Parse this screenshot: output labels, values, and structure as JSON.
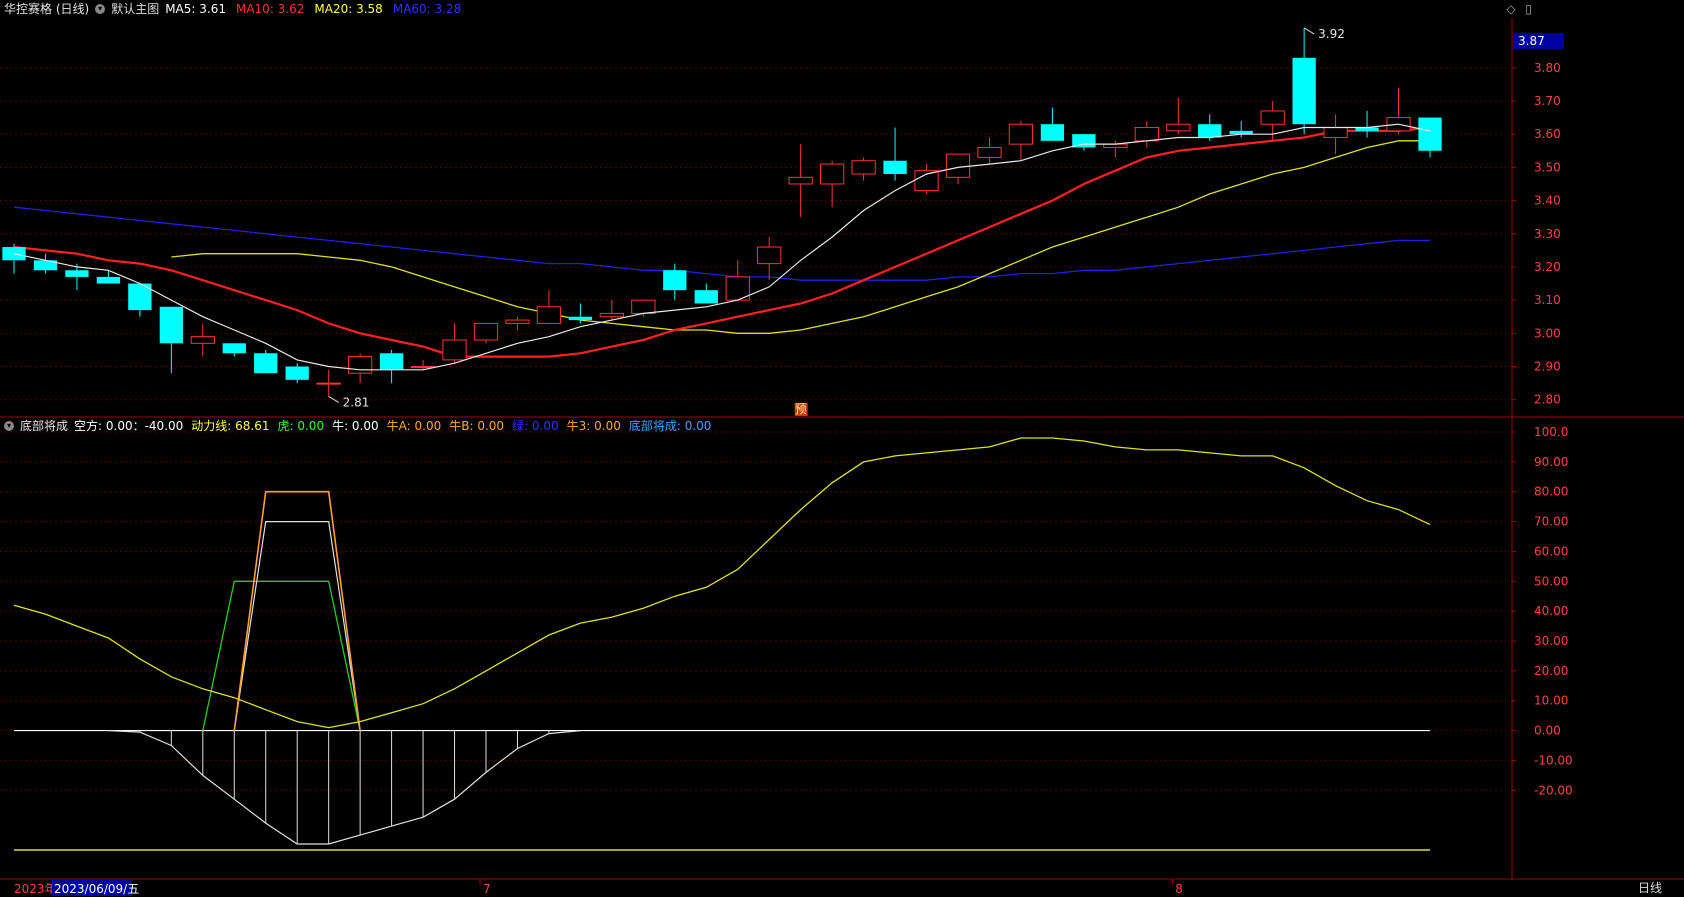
{
  "window": {
    "stock_name": "华控赛格 (日线)",
    "main_chart_label": "默认主图",
    "ma_labels": [
      {
        "text": "MA5: 3.61",
        "color": "#ffffff"
      },
      {
        "text": "MA10: 3.62",
        "color": "#ff3030"
      },
      {
        "text": "MA20: 3.58",
        "color": "#ffff40"
      },
      {
        "text": "MA60: 3.28",
        "color": "#3030ff"
      }
    ],
    "current_price_tag": "3.87",
    "high_label": "3.92",
    "low_label": "2.81",
    "forecast_badge": "预"
  },
  "indicator": {
    "name": "底部将成",
    "items": [
      {
        "text": "空方: 0.00：-40.00",
        "color": "#ffffff"
      },
      {
        "text": "动力线: 68.61",
        "color": "#ffff40"
      },
      {
        "text": "虎: 0.00",
        "color": "#30ff30"
      },
      {
        "text": "牛: 0.00",
        "color": "#ffffff"
      },
      {
        "text": "牛A: 0.00",
        "color": "#ffaa30"
      },
      {
        "text": "牛B: 0.00",
        "color": "#ffaa30"
      },
      {
        "text": "绿: 0.00",
        "color": "#3030ff"
      },
      {
        "text": "牛3: 0.00",
        "color": "#ffaa30"
      },
      {
        "text": "底部将成: 0.00",
        "color": "#40a0ff"
      }
    ]
  },
  "price_axis": {
    "ticks": [
      "3.80",
      "3.70",
      "3.60",
      "3.50",
      "3.40",
      "3.30",
      "3.20",
      "3.10",
      "3.00",
      "2.90",
      "2.80"
    ]
  },
  "ind_axis": {
    "ticks": [
      "100.0",
      "90.00",
      "80.00",
      "70.00",
      "60.00",
      "50.00",
      "40.00",
      "30.00",
      "20.00",
      "10.00",
      "0.00",
      "-10.00",
      "-20.00"
    ]
  },
  "time_axis": {
    "year_label": "2023年",
    "cursor_date": "2023/06/09/五",
    "month_marks": [
      "7",
      "8"
    ],
    "period_button": "日线"
  },
  "chart_data": [
    {
      "type": "candlestick",
      "title": "华控赛格 (日线)",
      "ylim": [
        2.76,
        3.95
      ],
      "candles": [
        {
          "o": 3.26,
          "h": 3.27,
          "l": 3.18,
          "c": 3.22
        },
        {
          "o": 3.22,
          "h": 3.24,
          "l": 3.18,
          "c": 3.19
        },
        {
          "o": 3.19,
          "h": 3.21,
          "l": 3.13,
          "c": 3.17
        },
        {
          "o": 3.17,
          "h": 3.19,
          "l": 3.15,
          "c": 3.15
        },
        {
          "o": 3.15,
          "h": 3.15,
          "l": 3.05,
          "c": 3.07
        },
        {
          "o": 3.08,
          "h": 3.08,
          "l": 2.88,
          "c": 2.97
        },
        {
          "o": 2.97,
          "h": 3.03,
          "l": 2.93,
          "c": 2.99
        },
        {
          "o": 2.97,
          "h": 2.97,
          "l": 2.93,
          "c": 2.94
        },
        {
          "o": 2.94,
          "h": 2.95,
          "l": 2.88,
          "c": 2.88
        },
        {
          "o": 2.9,
          "h": 2.91,
          "l": 2.85,
          "c": 2.86
        },
        {
          "o": 2.85,
          "h": 2.89,
          "l": 2.81,
          "c": 2.85
        },
        {
          "o": 2.88,
          "h": 2.94,
          "l": 2.85,
          "c": 2.93
        },
        {
          "o": 2.94,
          "h": 2.95,
          "l": 2.85,
          "c": 2.89
        },
        {
          "o": 2.9,
          "h": 2.92,
          "l": 2.89,
          "c": 2.9
        },
        {
          "o": 2.92,
          "h": 3.03,
          "l": 2.91,
          "c": 2.98
        },
        {
          "o": 2.98,
          "h": 3.02,
          "l": 2.97,
          "c": 3.03
        },
        {
          "o": 3.03,
          "h": 3.05,
          "l": 3.01,
          "c": 3.04
        },
        {
          "o": 3.03,
          "h": 3.13,
          "l": 3.03,
          "c": 3.08
        },
        {
          "o": 3.05,
          "h": 3.09,
          "l": 3.03,
          "c": 3.04
        },
        {
          "o": 3.05,
          "h": 3.1,
          "l": 3.04,
          "c": 3.06
        },
        {
          "o": 3.06,
          "h": 3.1,
          "l": 3.05,
          "c": 3.1
        },
        {
          "o": 3.19,
          "h": 3.21,
          "l": 3.1,
          "c": 3.13
        },
        {
          "o": 3.13,
          "h": 3.15,
          "l": 3.09,
          "c": 3.09
        },
        {
          "o": 3.1,
          "h": 3.22,
          "l": 3.1,
          "c": 3.17
        },
        {
          "o": 3.21,
          "h": 3.29,
          "l": 3.16,
          "c": 3.26
        },
        {
          "o": 3.45,
          "h": 3.57,
          "l": 3.35,
          "c": 3.47
        },
        {
          "o": 3.45,
          "h": 3.52,
          "l": 3.38,
          "c": 3.51
        },
        {
          "o": 3.48,
          "h": 3.53,
          "l": 3.46,
          "c": 3.52
        },
        {
          "o": 3.52,
          "h": 3.62,
          "l": 3.46,
          "c": 3.48
        },
        {
          "o": 3.43,
          "h": 3.51,
          "l": 3.42,
          "c": 3.49
        },
        {
          "o": 3.47,
          "h": 3.54,
          "l": 3.45,
          "c": 3.54
        },
        {
          "o": 3.53,
          "h": 3.59,
          "l": 3.51,
          "c": 3.56
        },
        {
          "o": 3.57,
          "h": 3.64,
          "l": 3.52,
          "c": 3.63
        },
        {
          "o": 3.63,
          "h": 3.68,
          "l": 3.58,
          "c": 3.58
        },
        {
          "o": 3.6,
          "h": 3.6,
          "l": 3.55,
          "c": 3.56
        },
        {
          "o": 3.56,
          "h": 3.58,
          "l": 3.53,
          "c": 3.57
        },
        {
          "o": 3.58,
          "h": 3.64,
          "l": 3.56,
          "c": 3.62
        },
        {
          "o": 3.61,
          "h": 3.71,
          "l": 3.6,
          "c": 3.63
        },
        {
          "o": 3.63,
          "h": 3.66,
          "l": 3.58,
          "c": 3.59
        },
        {
          "o": 3.61,
          "h": 3.64,
          "l": 3.59,
          "c": 3.6
        },
        {
          "o": 3.63,
          "h": 3.7,
          "l": 3.58,
          "c": 3.67
        },
        {
          "o": 3.83,
          "h": 3.92,
          "l": 3.6,
          "c": 3.63
        },
        {
          "o": 3.59,
          "h": 3.66,
          "l": 3.54,
          "c": 3.62
        },
        {
          "o": 3.62,
          "h": 3.67,
          "l": 3.59,
          "c": 3.61
        },
        {
          "o": 3.61,
          "h": 3.74,
          "l": 3.6,
          "c": 3.65
        },
        {
          "o": 3.65,
          "h": 3.65,
          "l": 3.53,
          "c": 3.55
        }
      ],
      "ma5": [
        3.24,
        3.22,
        3.2,
        3.19,
        3.15,
        3.1,
        3.05,
        3.01,
        2.97,
        2.92,
        2.9,
        2.89,
        2.89,
        2.89,
        2.91,
        2.94,
        2.97,
        2.99,
        3.02,
        3.04,
        3.06,
        3.07,
        3.08,
        3.1,
        3.14,
        3.22,
        3.29,
        3.37,
        3.43,
        3.48,
        3.5,
        3.51,
        3.52,
        3.55,
        3.57,
        3.57,
        3.58,
        3.59,
        3.59,
        3.6,
        3.6,
        3.62,
        3.62,
        3.62,
        3.63,
        3.61
      ],
      "ma10": [
        3.26,
        3.25,
        3.24,
        3.22,
        3.21,
        3.19,
        3.16,
        3.13,
        3.1,
        3.07,
        3.03,
        3.0,
        2.98,
        2.96,
        2.93,
        2.93,
        2.93,
        2.93,
        2.94,
        2.96,
        2.98,
        3.01,
        3.03,
        3.05,
        3.07,
        3.09,
        3.12,
        3.16,
        3.2,
        3.24,
        3.28,
        3.32,
        3.36,
        3.4,
        3.45,
        3.49,
        3.53,
        3.55,
        3.56,
        3.57,
        3.58,
        3.59,
        3.61,
        3.61,
        3.61,
        3.62
      ],
      "ma20": [
        3.23,
        3.24,
        3.24,
        3.24,
        3.24,
        3.23,
        3.22,
        3.2,
        3.17,
        3.14,
        3.11,
        3.08,
        3.06,
        3.04,
        3.03,
        3.02,
        3.01,
        3.01,
        3.0,
        3.0,
        3.01,
        3.03,
        3.05,
        3.08,
        3.11,
        3.14,
        3.18,
        3.22,
        3.26,
        3.29,
        3.32,
        3.35,
        3.38,
        3.42,
        3.45,
        3.48,
        3.5,
        3.53,
        3.56,
        3.58,
        3.58
      ],
      "ma20_start": 5,
      "ma60": [
        3.38,
        3.37,
        3.36,
        3.35,
        3.34,
        3.33,
        3.32,
        3.31,
        3.3,
        3.29,
        3.28,
        3.27,
        3.26,
        3.25,
        3.24,
        3.23,
        3.22,
        3.21,
        3.21,
        3.2,
        3.19,
        3.19,
        3.18,
        3.17,
        3.17,
        3.16,
        3.16,
        3.16,
        3.16,
        3.16,
        3.17,
        3.17,
        3.18,
        3.18,
        3.19,
        3.19,
        3.2,
        3.21,
        3.22,
        3.23,
        3.24,
        3.25,
        3.26,
        3.27,
        3.28,
        3.28
      ]
    },
    {
      "type": "line",
      "title": "底部将成",
      "ylim": [
        -40,
        100
      ],
      "series": [
        {
          "name": "动力线",
          "values": [
            42,
            39,
            35,
            31,
            24,
            18,
            14,
            11,
            7,
            3,
            1,
            3,
            6,
            9,
            14,
            20,
            26,
            32,
            36,
            38,
            41,
            45,
            48,
            54,
            64,
            74,
            83,
            90,
            92,
            93,
            94,
            95,
            98,
            98,
            97,
            95,
            94,
            94,
            93,
            92,
            92,
            88,
            82,
            77,
            74,
            69
          ]
        },
        {
          "name": "空方",
          "values": [
            0,
            0,
            0,
            0,
            -0.5,
            -5,
            -15,
            -23,
            -31,
            -38,
            -38,
            -35,
            -32,
            -29,
            -23,
            -14,
            -6,
            -1,
            0,
            0,
            0,
            0,
            0,
            0,
            0,
            0,
            0,
            0,
            0,
            0,
            0,
            0,
            0,
            0,
            0,
            0,
            0,
            0,
            0,
            0,
            0,
            0,
            0,
            0,
            0,
            0
          ]
        },
        {
          "name": "虎",
          "values": [
            null,
            null,
            null,
            null,
            null,
            null,
            0,
            50,
            50,
            50,
            50,
            0
          ]
        },
        {
          "name": "牛",
          "values": [
            null,
            null,
            null,
            null,
            null,
            null,
            null,
            0,
            70,
            70,
            70,
            0
          ]
        },
        {
          "name": "牛A",
          "values": [
            null,
            null,
            null,
            null,
            null,
            null,
            null,
            0,
            80,
            80,
            80,
            0
          ]
        },
        {
          "name": "牛B",
          "values": [
            0,
            0,
            0,
            0,
            0,
            0,
            0,
            0,
            0,
            0,
            0,
            0,
            0,
            0,
            0,
            0,
            0,
            0,
            0,
            0,
            0,
            0,
            0,
            0,
            0,
            0,
            0,
            0,
            0,
            0,
            0,
            0,
            0,
            0,
            0,
            0,
            0,
            0,
            0,
            0,
            0,
            0,
            0,
            0,
            0,
            0
          ]
        }
      ]
    }
  ]
}
